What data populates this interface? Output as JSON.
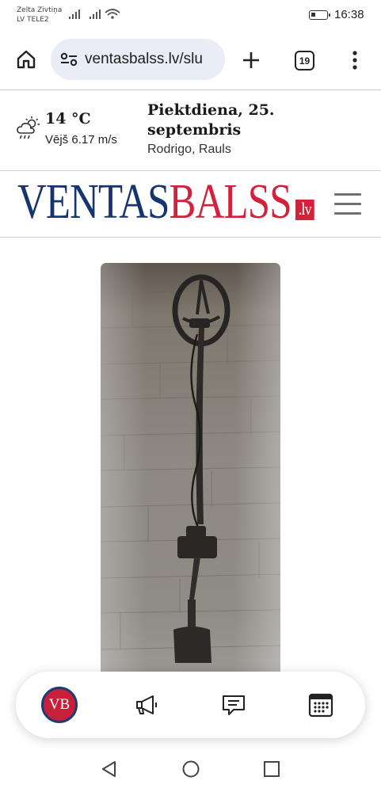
{
  "status_bar": {
    "carrier_line1": "Zelta Zivtiņa",
    "carrier_line2": "LV TELE2",
    "battery_level": 0.3,
    "time": "16:38"
  },
  "browser": {
    "url": "ventasbalss.lv/slu",
    "tab_count": "19",
    "icons": [
      "home-icon",
      "site-settings-icon",
      "new-tab-icon",
      "tab-switcher-icon",
      "more-menu-icon"
    ]
  },
  "info_strip": {
    "weather_icon": "rain-sun-cloud-icon",
    "temperature": "14 °C",
    "wind": "Vējš 6.17 m/s",
    "date": "Piektdiena, 25. septembris",
    "namedays": "Rodrigo, Rauls"
  },
  "logo": {
    "part1": "VENTAS",
    "part2": "BALSS",
    "domain": ".lv",
    "colors": {
      "navy": "#16356e",
      "red": "#d4213b"
    }
  },
  "article": {
    "image_subject": "metal-detector-photo"
  },
  "bottom_nav": {
    "vb_label": "VB",
    "icons": [
      "megaphone-icon",
      "comment-icon",
      "calendar-icon"
    ]
  },
  "system_nav": {
    "icons": [
      "back-icon",
      "home-circle-icon",
      "recents-icon"
    ]
  }
}
